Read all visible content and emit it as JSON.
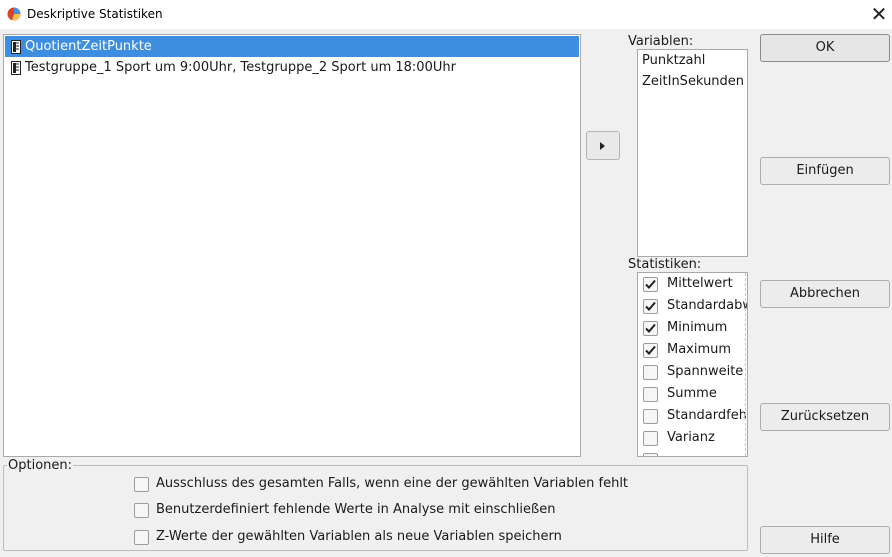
{
  "window": {
    "title": "Deskriptive Statistiken",
    "close_glyph": "✕"
  },
  "source_list": {
    "items": [
      {
        "label": "QuotientZeitPunkte",
        "selected": true,
        "icon": "ruler-variable-icon"
      },
      {
        "label": "Testgruppe_1 Sport um 9:00Uhr, Testgruppe_2 Sport um 18:00Uhr",
        "selected": false,
        "icon": "ruler-variable-icon"
      }
    ]
  },
  "variables": {
    "label": "Variablen:",
    "items": [
      "Punktzahl",
      "ZeitInSekunden"
    ]
  },
  "statistics": {
    "label": "Statistiken:",
    "items": [
      {
        "label": "Mittelwert",
        "checked": true
      },
      {
        "label": "Standardabw",
        "checked": true
      },
      {
        "label": "Minimum",
        "checked": true
      },
      {
        "label": "Maximum",
        "checked": true
      },
      {
        "label": "Spannweite",
        "checked": false
      },
      {
        "label": "Summe",
        "checked": false
      },
      {
        "label": "Standardfehl",
        "checked": false
      },
      {
        "label": "Varianz",
        "checked": false
      }
    ]
  },
  "buttons": {
    "ok": "OK",
    "paste": "Einfügen",
    "cancel": "Abbrechen",
    "reset": "Zurücksetzen",
    "help": "Hilfe"
  },
  "options": {
    "label": "Optionen:",
    "items": [
      {
        "label": "Ausschluss des gesamten Falls, wenn eine der gewählten Variablen fehlt",
        "checked": false
      },
      {
        "label": "Benutzerdefiniert fehlende Werte in Analyse mit einschließen",
        "checked": false
      },
      {
        "label": "Z-Werte der gewählten Variablen als neue Variablen speichern",
        "checked": false
      }
    ]
  },
  "colors": {
    "selection": "#3d8ee0",
    "background": "#f0f0f0"
  }
}
